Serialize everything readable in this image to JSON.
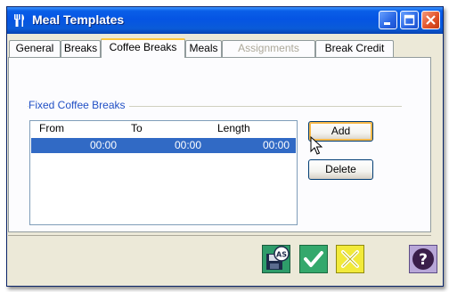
{
  "window": {
    "title": "Meal Templates",
    "app_icon": "fork-knife-icon",
    "controls": [
      "minimize-icon",
      "maximize-icon",
      "close-icon"
    ]
  },
  "tabs": [
    {
      "label": "General",
      "state": "normal"
    },
    {
      "label": "Breaks",
      "state": "normal"
    },
    {
      "label": "Coffee Breaks",
      "state": "active"
    },
    {
      "label": "Meals",
      "state": "normal"
    },
    {
      "label": "Assignments",
      "state": "disabled"
    },
    {
      "label": "Break Credit",
      "state": "normal"
    }
  ],
  "fixed_coffee_breaks": {
    "title": "Fixed Coffee Breaks",
    "columns": [
      "From",
      "To",
      "Length"
    ],
    "rows": [
      {
        "from": "00:00",
        "to": "00:00",
        "length": "00:00",
        "selected": true
      }
    ],
    "add_label": "Add",
    "delete_label": "Delete"
  },
  "footer": {
    "buttons": [
      "save-as-icon",
      "ok-check-icon",
      "cancel-x-icon",
      "help-question-icon"
    ]
  },
  "colors": {
    "title_bar": "#0554e3",
    "selection": "#316ac5",
    "group_title": "#2150c5",
    "active_tab_accent": "#ffc83c"
  }
}
